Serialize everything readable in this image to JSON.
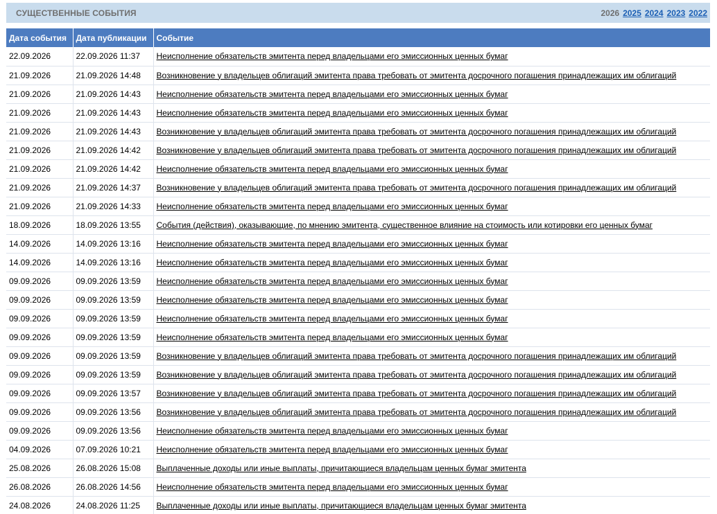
{
  "header": {
    "title": "СУЩЕСТВЕННЫЕ СОБЫТИЯ",
    "years": [
      {
        "label": "2026",
        "current": true
      },
      {
        "label": "2025",
        "current": false
      },
      {
        "label": "2024",
        "current": false
      },
      {
        "label": "2023",
        "current": false
      },
      {
        "label": "2022",
        "current": false
      }
    ]
  },
  "table": {
    "columns": [
      "Дата события",
      "Дата публикации",
      "Событие"
    ],
    "rows": [
      {
        "event_date": "22.09.2026",
        "pub_date": "22.09.2026 11:37",
        "event": "Неисполнение обязательств эмитента перед владельцами его эмиссионных ценных бумаг"
      },
      {
        "event_date": "21.09.2026",
        "pub_date": "21.09.2026 14:48",
        "event": "Возникновение у владельцев облигаций эмитента права требовать от эмитента досрочного погашения принадлежащих им облигаций"
      },
      {
        "event_date": "21.09.2026",
        "pub_date": "21.09.2026 14:43",
        "event": "Неисполнение обязательств эмитента перед владельцами его эмиссионных ценных бумаг"
      },
      {
        "event_date": "21.09.2026",
        "pub_date": "21.09.2026 14:43",
        "event": "Неисполнение обязательств эмитента перед владельцами его эмиссионных ценных бумаг"
      },
      {
        "event_date": "21.09.2026",
        "pub_date": "21.09.2026 14:43",
        "event": "Возникновение у владельцев облигаций эмитента права требовать от эмитента досрочного погашения принадлежащих им облигаций"
      },
      {
        "event_date": "21.09.2026",
        "pub_date": "21.09.2026 14:42",
        "event": "Возникновение у владельцев облигаций эмитента права требовать от эмитента досрочного погашения принадлежащих им облигаций"
      },
      {
        "event_date": "21.09.2026",
        "pub_date": "21.09.2026 14:42",
        "event": "Неисполнение обязательств эмитента перед владельцами его эмиссионных ценных бумаг"
      },
      {
        "event_date": "21.09.2026",
        "pub_date": "21.09.2026 14:37",
        "event": "Возникновение у владельцев облигаций эмитента права требовать от эмитента досрочного погашения принадлежащих им облигаций"
      },
      {
        "event_date": "21.09.2026",
        "pub_date": "21.09.2026 14:33",
        "event": "Неисполнение обязательств эмитента перед владельцами его эмиссионных ценных бумаг"
      },
      {
        "event_date": "18.09.2026",
        "pub_date": "18.09.2026 13:55",
        "event": "События (действия), оказывающие, по мнению эмитента, существенное влияние на стоимость или котировки его ценных бумаг"
      },
      {
        "event_date": "14.09.2026",
        "pub_date": "14.09.2026 13:16",
        "event": "Неисполнение обязательств эмитента перед владельцами его эмиссионных ценных бумаг"
      },
      {
        "event_date": "14.09.2026",
        "pub_date": "14.09.2026 13:16",
        "event": "Неисполнение обязательств эмитента перед владельцами его эмиссионных ценных бумаг"
      },
      {
        "event_date": "09.09.2026",
        "pub_date": "09.09.2026 13:59",
        "event": "Неисполнение обязательств эмитента перед владельцами его эмиссионных ценных бумаг"
      },
      {
        "event_date": "09.09.2026",
        "pub_date": "09.09.2026 13:59",
        "event": "Неисполнение обязательств эмитента перед владельцами его эмиссионных ценных бумаг"
      },
      {
        "event_date": "09.09.2026",
        "pub_date": "09.09.2026 13:59",
        "event": "Неисполнение обязательств эмитента перед владельцами его эмиссионных ценных бумаг"
      },
      {
        "event_date": "09.09.2026",
        "pub_date": "09.09.2026 13:59",
        "event": "Неисполнение обязательств эмитента перед владельцами его эмиссионных ценных бумаг"
      },
      {
        "event_date": "09.09.2026",
        "pub_date": "09.09.2026 13:59",
        "event": "Возникновение у владельцев облигаций эмитента права требовать от эмитента досрочного погашения принадлежащих им облигаций"
      },
      {
        "event_date": "09.09.2026",
        "pub_date": "09.09.2026 13:59",
        "event": "Возникновение у владельцев облигаций эмитента права требовать от эмитента досрочного погашения принадлежащих им облигаций"
      },
      {
        "event_date": "09.09.2026",
        "pub_date": "09.09.2026 13:57",
        "event": "Возникновение у владельцев облигаций эмитента права требовать от эмитента досрочного погашения принадлежащих им облигаций"
      },
      {
        "event_date": "09.09.2026",
        "pub_date": "09.09.2026 13:56",
        "event": "Возникновение у владельцев облигаций эмитента права требовать от эмитента досрочного погашения принадлежащих им облигаций"
      },
      {
        "event_date": "09.09.2026",
        "pub_date": "09.09.2026 13:56",
        "event": "Неисполнение обязательств эмитента перед владельцами его эмиссионных ценных бумаг"
      },
      {
        "event_date": "04.09.2026",
        "pub_date": "07.09.2026 10:21",
        "event": "Неисполнение обязательств эмитента перед владельцами его эмиссионных ценных бумаг"
      },
      {
        "event_date": "25.08.2026",
        "pub_date": "26.08.2026 15:08",
        "event": "Выплаченные доходы или иные выплаты, причитающиеся владельцам ценных бумаг эмитента"
      },
      {
        "event_date": "26.08.2026",
        "pub_date": "26.08.2026 14:56",
        "event": "Неисполнение обязательств эмитента перед владельцами его эмиссионных ценных бумаг"
      },
      {
        "event_date": "24.08.2026",
        "pub_date": "24.08.2026 11:25",
        "event": "Выплаченные доходы или иные выплаты, причитающиеся владельцам ценных бумаг эмитента"
      }
    ]
  }
}
